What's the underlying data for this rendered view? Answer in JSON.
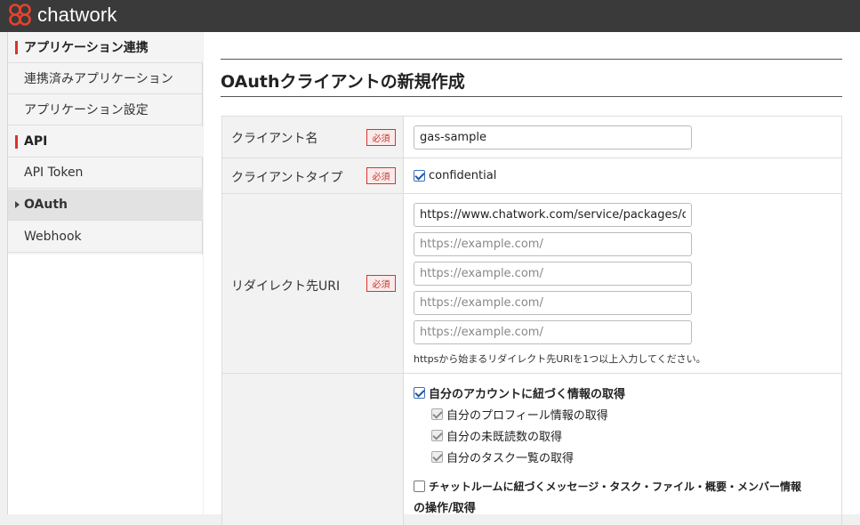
{
  "brand": {
    "name": "chatwork"
  },
  "sidebar": {
    "items": [
      {
        "label": "アプリケーション連携",
        "kind": "header"
      },
      {
        "label": "連携済みアプリケーション",
        "kind": "sub"
      },
      {
        "label": "アプリケーション設定",
        "kind": "sub"
      },
      {
        "label": "API",
        "kind": "header"
      },
      {
        "label": "API Token",
        "kind": "sub"
      },
      {
        "label": "OAuth",
        "kind": "active"
      },
      {
        "label": "Webhook",
        "kind": "sub"
      }
    ]
  },
  "page": {
    "title": "OAuthクライアントの新規作成"
  },
  "form": {
    "required_badge": "必須",
    "client_name": {
      "label": "クライアント名",
      "value": "gas-sample"
    },
    "client_type": {
      "label": "クライアントタイプ",
      "option": "confidential",
      "checked": true
    },
    "redirect": {
      "label": "リダイレクト先URI",
      "uris": [
        {
          "value": "https://www.chatwork.com/service/packages/c",
          "placeholder": "https://example.com/"
        },
        {
          "value": "",
          "placeholder": "https://example.com/"
        },
        {
          "value": "",
          "placeholder": "https://example.com/"
        },
        {
          "value": "",
          "placeholder": "https://example.com/"
        },
        {
          "value": "",
          "placeholder": "https://example.com/"
        }
      ],
      "hint": "httpsから始まるリダイレクト先URIを1つ以上入力してください。"
    },
    "scopes": {
      "account": {
        "label": "自分のアカウントに紐づく情報の取得",
        "checked": true
      },
      "account_children": [
        {
          "label": "自分のプロフィール情報の取得"
        },
        {
          "label": "自分の未既読数の取得"
        },
        {
          "label": "自分のタスク一覧の取得"
        }
      ],
      "rooms": {
        "label_line1": "チャットルームに紐づくメッセージ・タスク・ファイル・概要・メンバー情報",
        "label_line2": "の操作/取得",
        "checked": false
      }
    }
  },
  "colors": {
    "topbar": "#3a3a3a",
    "accent_red": "#d9342b",
    "checkbox_blue": "#1f56a8"
  }
}
